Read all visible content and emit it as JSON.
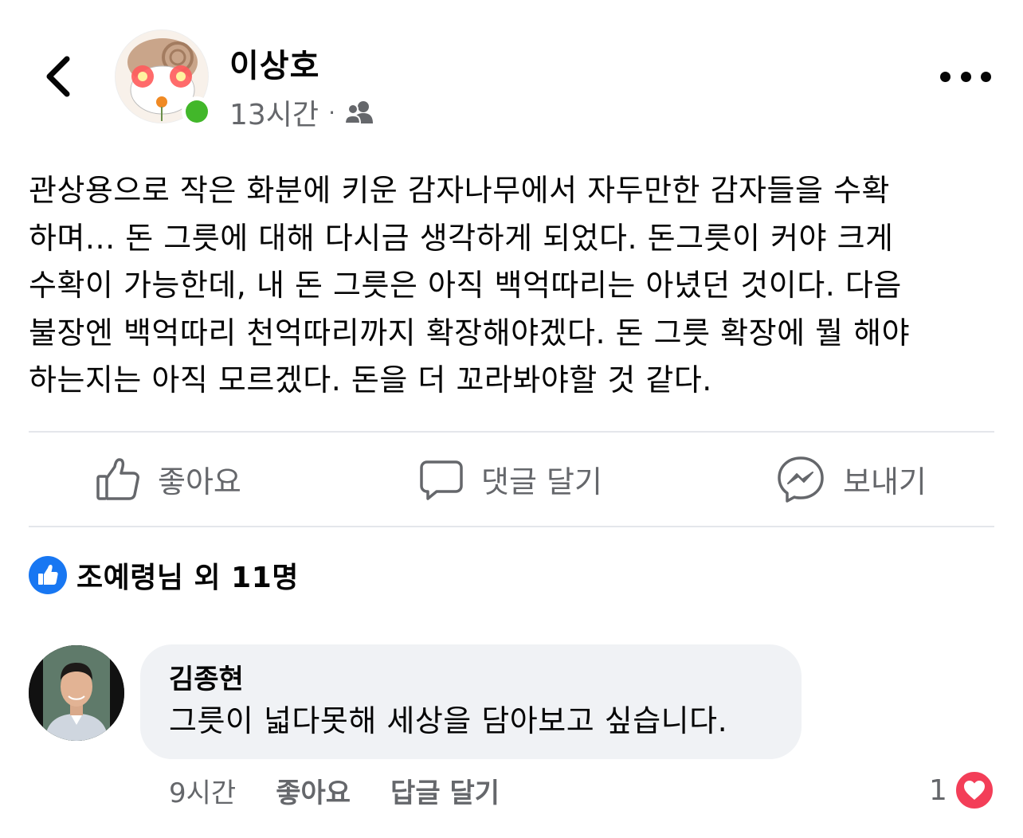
{
  "post": {
    "author": "이상호",
    "time": "13시간",
    "separator": "·",
    "audience_icon": "friends-icon",
    "online_color": "#42b72a",
    "text": "관상용으로 작은 화분에 키운 감자나무에서 자두만한 감자들을 수확\n하며... 돈 그릇에 대해 다시금 생각하게 되었다. 돈그릇이 커야 크게\n수확이 가능한데, 내 돈 그릇은 아직 백억따리는 아녔던 것이다. 다음\n불장엔 백억따리 천억따리까지 확장해야겠다. 돈 그릇 확장에 뭘 해야\n하는지는 아직 모르겠다. 돈을 더 꼬라봐야할 것 같다."
  },
  "actions": {
    "like_label": "좋아요",
    "comment_label": "댓글 달기",
    "send_label": "보내기"
  },
  "reactions": {
    "summary": "조예령님 외 11명",
    "accent": "#1877f2"
  },
  "comment": {
    "author": "김종현",
    "text": "그릇이 넓다못해 세상을 담아보고 싶습니다.",
    "time": "9시간",
    "like_label": "좋아요",
    "reply_label": "답글 달기",
    "reaction_count": "1",
    "reaction_color": "#f33e58"
  }
}
